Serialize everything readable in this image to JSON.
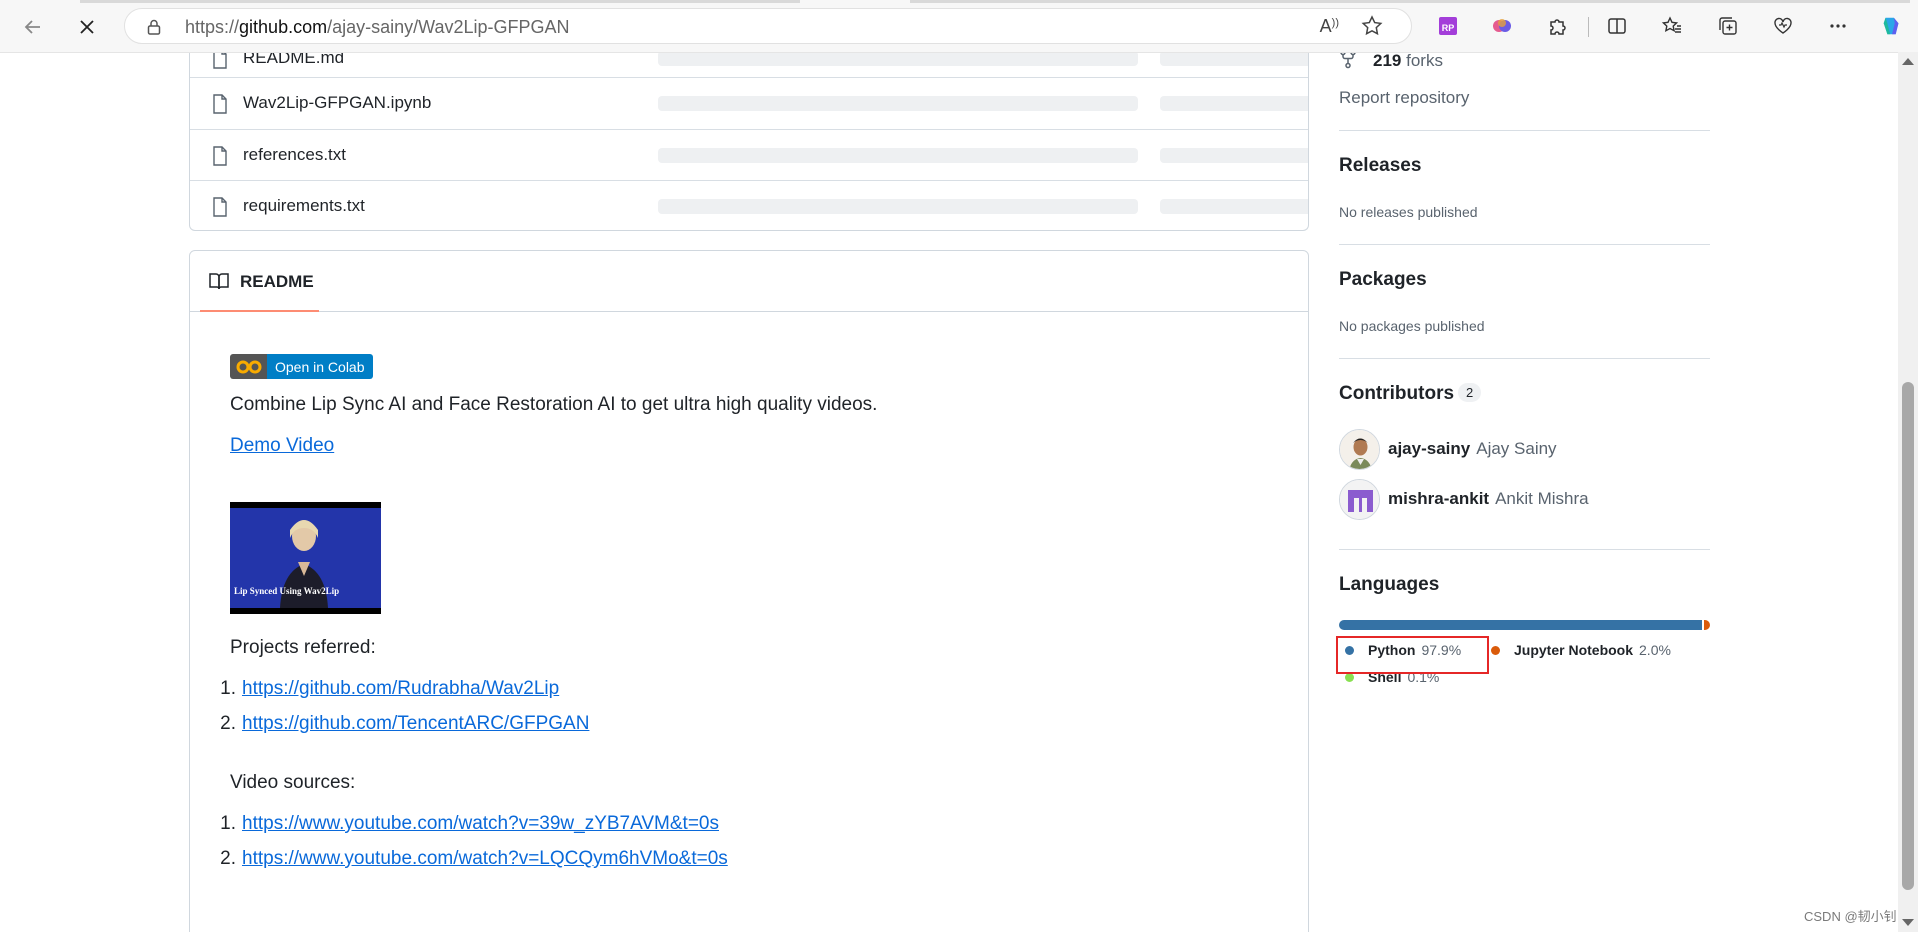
{
  "browser": {
    "url_prefix": "https://",
    "url_domain": "github.com",
    "url_path": "/ajay-sainy/Wav2Lip-GFPGAN",
    "read_aloud_label": "A͡"
  },
  "files": [
    {
      "name": "README.md"
    },
    {
      "name": "Wav2Lip-GFPGAN.ipynb"
    },
    {
      "name": "references.txt"
    },
    {
      "name": "requirements.txt"
    }
  ],
  "readme": {
    "tab_label": "README",
    "colab_badge": "Open in Colab",
    "description": "Combine Lip Sync AI and Face Restoration AI to get ultra high quality videos.",
    "demo_link": "Demo Video",
    "thumbnail_caption": "Lip Synced Using Wav2Lip",
    "projects_heading": "Projects referred:",
    "projects": [
      {
        "num": "1.",
        "url": "https://github.com/Rudrabha/Wav2Lip"
      },
      {
        "num": "2.",
        "url": "https://github.com/TencentARC/GFPGAN"
      }
    ],
    "sources_heading": "Video sources:",
    "sources": [
      {
        "num": "1.",
        "url": "https://www.youtube.com/watch?v=39w_zYB7AVM&t=0s"
      },
      {
        "num": "2.",
        "url": "https://www.youtube.com/watch?v=LQCQym6hVMo&t=0s"
      }
    ]
  },
  "sidebar": {
    "forks_count": "219",
    "forks_label": "forks",
    "report": "Report repository",
    "releases_heading": "Releases",
    "releases_empty": "No releases published",
    "packages_heading": "Packages",
    "packages_empty": "No packages published",
    "contributors_heading": "Contributors",
    "contributors_count": "2",
    "contributors": [
      {
        "login": "ajay-sainy",
        "name": "Ajay Sainy"
      },
      {
        "login": "mishra-ankit",
        "name": "Ankit Mishra"
      }
    ],
    "languages_heading": "Languages",
    "languages": [
      {
        "name": "Python",
        "percent": "97.9%",
        "share": 97.9,
        "color": "#3572A5"
      },
      {
        "name": "Jupyter Notebook",
        "percent": "2.0%",
        "share": 2.0,
        "color": "#DA5B0B"
      },
      {
        "name": "Shell",
        "percent": "0.1%",
        "share": 0.1,
        "color": "#89e051"
      }
    ]
  },
  "watermark": "CSDN @韧小钊"
}
